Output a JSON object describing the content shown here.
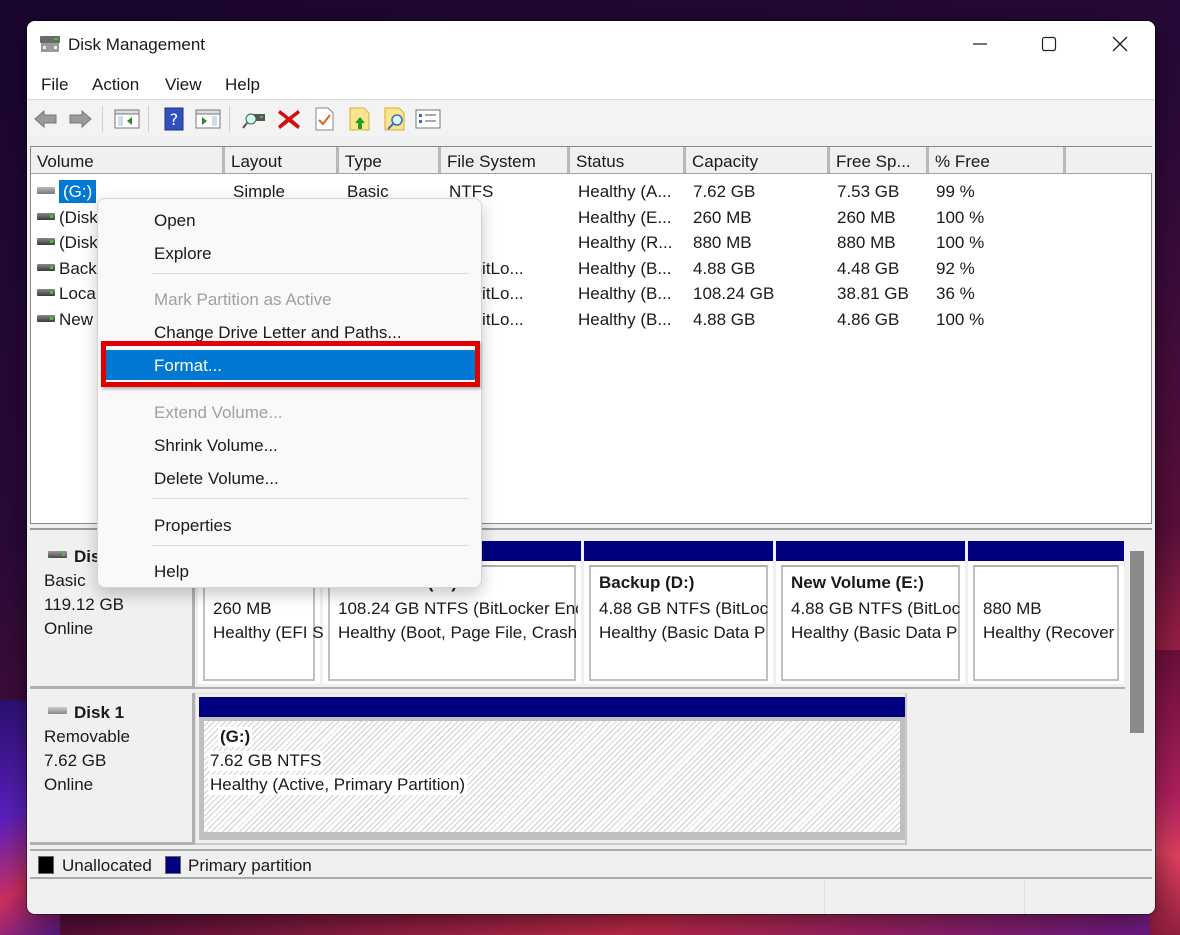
{
  "window": {
    "title": "Disk Management",
    "app_icon": "disk-management-icon",
    "controls": [
      "minimize",
      "maximize",
      "close"
    ]
  },
  "menubar": [
    "File",
    "Action",
    "View",
    "Help"
  ],
  "toolbar": {
    "buttons": [
      "back-icon",
      "forward-icon",
      "show-hide-console-tree-icon",
      "help-icon",
      "show-hide-action-pane-icon",
      "connect-disk-icon",
      "delete-icon",
      "check-icon",
      "folder-up-icon",
      "folder-search-icon",
      "properties-list-icon"
    ]
  },
  "volume_list": {
    "columns": [
      "Volume",
      "Layout",
      "Type",
      "File System",
      "Status",
      "Capacity",
      "Free Sp...",
      "% Free"
    ],
    "rows": [
      {
        "volume": "(G:)",
        "layout": "Simple",
        "type": "Basic",
        "fs": "NTFS",
        "status": "Healthy (A...",
        "capacity": "7.62 GB",
        "free": "7.53 GB",
        "pct": "99 %",
        "selected": true
      },
      {
        "volume": "(Disk",
        "layout": "",
        "type": "",
        "fs": "",
        "status": "Healthy (E...",
        "capacity": "260 MB",
        "free": "260 MB",
        "pct": "100 %"
      },
      {
        "volume": "(Disk",
        "layout": "",
        "type": "",
        "fs": "",
        "status": "Healthy (R...",
        "capacity": "880 MB",
        "free": "880 MB",
        "pct": "100 %"
      },
      {
        "volume": "Back",
        "layout": "",
        "type": "",
        "fs": "S (BitLo...",
        "status": "Healthy (B...",
        "capacity": "4.88 GB",
        "free": "4.48 GB",
        "pct": "92 %"
      },
      {
        "volume": "Loca",
        "layout": "",
        "type": "",
        "fs": "S (BitLo...",
        "status": "Healthy (B...",
        "capacity": "108.24 GB",
        "free": "38.81 GB",
        "pct": "36 %"
      },
      {
        "volume": "New",
        "layout": "",
        "type": "",
        "fs": "S (BitLo...",
        "status": "Healthy (B...",
        "capacity": "4.88 GB",
        "free": "4.86 GB",
        "pct": "100 %"
      }
    ]
  },
  "disks": [
    {
      "name": "Dis",
      "type": "Basic",
      "size": "119.12 GB",
      "state": "Online",
      "partitions": [
        {
          "title": "",
          "line1": "260 MB",
          "line2": "Healthy (EFI S"
        },
        {
          "title": "Local Disk (C:)",
          "line1": "108.24 GB NTFS (BitLocker Enc",
          "line2": "Healthy (Boot, Page File, Crash"
        },
        {
          "title": "Backup  (D:)",
          "line1": "4.88 GB NTFS (BitLoc",
          "line2": "Healthy (Basic Data P"
        },
        {
          "title": "New Volume  (E:)",
          "line1": "4.88 GB NTFS (BitLoc",
          "line2": "Healthy (Basic Data P"
        },
        {
          "title": "",
          "line1": "880 MB",
          "line2": "Healthy (Recover"
        }
      ]
    },
    {
      "name": "Disk 1",
      "type": "Removable",
      "size": "7.62 GB",
      "state": "Online",
      "partitions": [
        {
          "title": "(G:)",
          "line1": "7.62 GB NTFS",
          "line2": "Healthy (Active, Primary Partition)"
        }
      ]
    }
  ],
  "legend": [
    {
      "label": "Unallocated",
      "color": "#000000"
    },
    {
      "label": "Primary partition",
      "color": "#000080"
    }
  ],
  "context_menu": {
    "items": [
      {
        "label": "Open",
        "enabled": true
      },
      {
        "label": "Explore",
        "enabled": true
      },
      {
        "label": "Mark Partition as Active",
        "enabled": false
      },
      {
        "label": "Change Drive Letter and Paths...",
        "enabled": true
      },
      {
        "label": "Format...",
        "enabled": true,
        "highlighted": true
      },
      {
        "label": "Extend Volume...",
        "enabled": false
      },
      {
        "label": "Shrink Volume...",
        "enabled": true
      },
      {
        "label": "Delete Volume...",
        "enabled": true
      },
      {
        "label": "Properties",
        "enabled": true
      },
      {
        "label": "Help",
        "enabled": true
      }
    ]
  },
  "colors": {
    "selection": "#0078d4",
    "primary_partition": "#000080",
    "annotation_box": "#e00000"
  }
}
